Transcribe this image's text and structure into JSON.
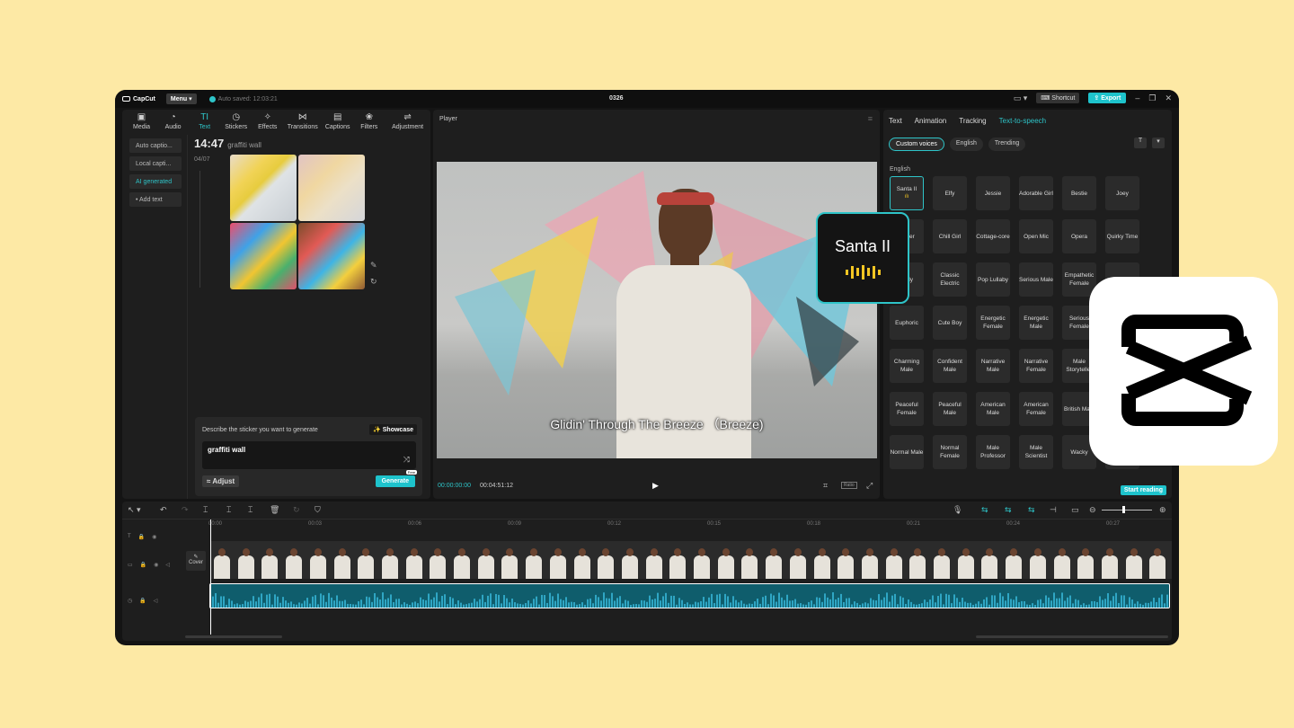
{
  "titlebar": {
    "app_name": "CapCut",
    "menu_label": "Menu",
    "autosave_text": "Auto saved: 12:03:21",
    "project_title": "0326",
    "shortcut_label": "Shortcut",
    "export_label": "Export"
  },
  "media_panel": {
    "tools": [
      {
        "icon": "media-icon",
        "glyph": "▣",
        "label": "Media"
      },
      {
        "icon": "audio-icon",
        "glyph": "◔",
        "label": "Audio"
      },
      {
        "icon": "text-icon",
        "glyph": "TI",
        "label": "Text"
      },
      {
        "icon": "stickers-icon",
        "glyph": "◷",
        "label": "Stickers"
      },
      {
        "icon": "effects-icon",
        "glyph": "✧",
        "label": "Effects"
      },
      {
        "icon": "transitions-icon",
        "glyph": "⋈",
        "label": "Transitions"
      },
      {
        "icon": "captions-icon",
        "glyph": "▤",
        "label": "Captions"
      },
      {
        "icon": "filters-icon",
        "glyph": "❀",
        "label": "Filters"
      },
      {
        "icon": "adjustment-icon",
        "glyph": "⇌",
        "label": "Adjustment"
      }
    ],
    "active_tool": "Text",
    "subnav": [
      "Auto captio...",
      "Local capti...",
      "AI generated",
      "• Add text"
    ],
    "active_subnav": "AI generated",
    "time": "14:47",
    "query": "graffiti wall",
    "date": "04/07",
    "generator": {
      "label": "Describe the sticker you want to generate",
      "showcase_label": "✨ Showcase",
      "prompt_value": "graffiti wall",
      "adjust_label": "≈ Adjust",
      "generate_label": "Generate",
      "free_badge": "Free"
    }
  },
  "player": {
    "title": "Player",
    "subtitle": "Glidin' Through The Breeze （Breeze)",
    "current_time": "00:00:00:00",
    "total_time": "00:04:51:12",
    "ratio_label": "Ratio"
  },
  "tts_panel": {
    "tabs": [
      "Text",
      "Animation",
      "Tracking",
      "Text-to-speech"
    ],
    "active_tab": "Text-to-speech",
    "filters": [
      "Custom voices",
      "English",
      "Trending"
    ],
    "active_filter": "Custom voices",
    "language_heading": "English",
    "voices": [
      "Santa II",
      "Elfy",
      "Jessie",
      "Adorable Girl",
      "Bestie",
      "Joey",
      "Jester",
      "Chill Girl",
      "Cottage-core",
      "Open Mic",
      "Opera",
      "Quirky Time",
      "Lady",
      "Classic Electric",
      "Pop Lullaby",
      "Serious Male",
      "Empathetic Female",
      "Hype",
      "Euphoric",
      "Cute Boy",
      "Energetic Female",
      "Energetic Male",
      "Serious Female",
      "",
      "Charming Male",
      "Confident Male",
      "Narrative Male",
      "Narrative Female",
      "Male Storyteller",
      "",
      "Peaceful Female",
      "Peaceful Male",
      "American Male",
      "American Female",
      "British Male",
      "",
      "Normal Male",
      "Normal Female",
      "Male Professor",
      "Male Scientist",
      "Wacky",
      ""
    ],
    "selected_voice": "Santa II",
    "start_reading_label": "Start reading"
  },
  "voice_toast": {
    "name": "Santa II",
    "accent_color": "#2ec4c8",
    "wave_color": "#f3c623"
  },
  "timeline": {
    "cover_label": "Cover",
    "ruler_ticks": [
      "00:00",
      "00:03",
      "00:06",
      "00:09",
      "00:12",
      "00:15",
      "00:18",
      "00:21",
      "00:24",
      "00:27"
    ]
  },
  "colors": {
    "background": "#fde9a5",
    "accent": "#1ec3cc"
  }
}
